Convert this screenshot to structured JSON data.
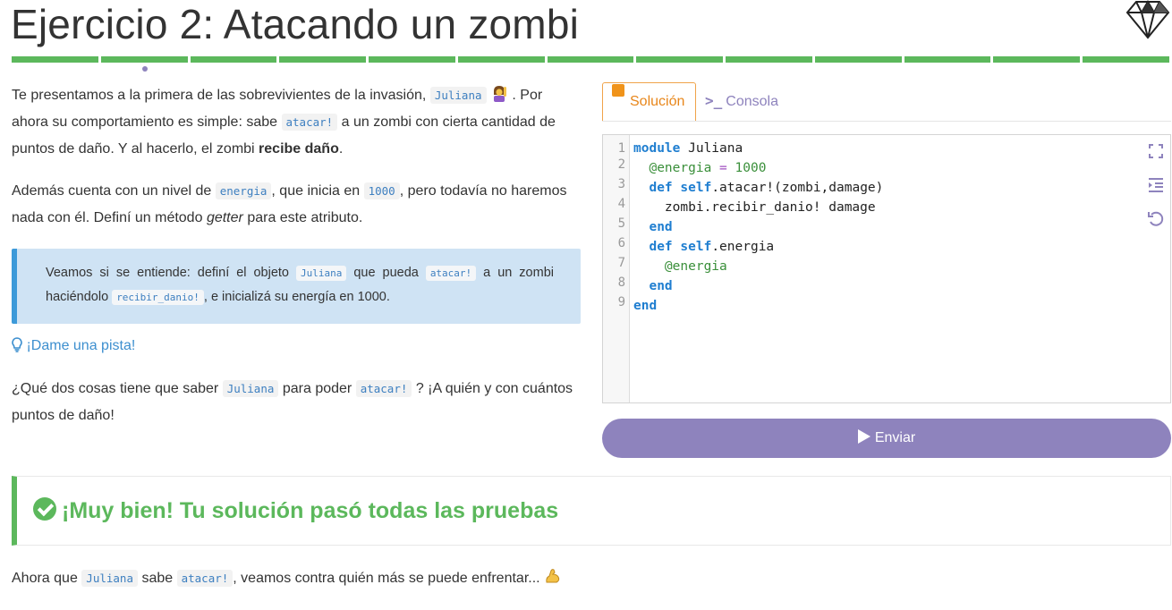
{
  "exercise": {
    "title": "Ejercicio 2: Atacando un zombi"
  },
  "progress": {
    "segments": 13,
    "current_index": 1
  },
  "description": {
    "p1_a": "Te presentamos a la primera de las sobrevivientes de la invasión,",
    "p1_code_name": "Juliana",
    "p1_b": ". Por ahora su comportamiento es simple: sabe",
    "p1_code_attack": "atacar!",
    "p1_c": "a un zombi con cierta cantidad de puntos de daño. Y al hacerlo, el zombi",
    "p1_bold": "recibe daño",
    "p1_d": ".",
    "p2_a": "Además cuenta con un nivel de",
    "p2_code_energy": "energia",
    "p2_b": ", que inicia en",
    "p2_code_1000": "1000",
    "p2_c": ", pero todavía no haremos nada con él. Definí un método",
    "p2_em": "getter",
    "p2_d": "para este atributo."
  },
  "callout": {
    "a": "Veamos si se entiende: definí el objeto",
    "code_name": "Juliana",
    "b": "que pueda",
    "code_attack": "atacar!",
    "c": "a un zombi haciéndolo",
    "code_receive": "recibir_danio!",
    "d": ", e inicializá su energía en 1000."
  },
  "hint": {
    "label": "¡Dame una pista!"
  },
  "question": {
    "a": "¿Qué dos cosas tiene que saber",
    "code_name": "Juliana",
    "b": "para poder",
    "code_attack": "atacar!",
    "c": "? ¡A quién y con cuántos puntos de daño!"
  },
  "tabs": {
    "solution": "Solución",
    "console": "Consola"
  },
  "editor": {
    "lines": [
      "module Juliana",
      "  @energia = 1000",
      "  def self.atacar!(zombi,damage)",
      "    zombi.recibir_danio! damage",
      "  end",
      "  def self.energia",
      "    @energia",
      "  end",
      "end"
    ]
  },
  "send_button": {
    "label": "Enviar"
  },
  "result": {
    "message": "¡Muy bien! Tu solución pasó todas las pruebas"
  },
  "corollary": {
    "a": "Ahora que",
    "code_name": "Juliana",
    "b": "sabe",
    "code_attack": "atacar!",
    "c": ", veamos contra quién más se puede enfrentar..."
  },
  "colors": {
    "success": "#5cb85c",
    "brand": "#8e83bd",
    "info": "#3d9ad9",
    "accent": "#f0931a"
  },
  "icons": [
    "ruby-logo-icon",
    "woman-raising-hand-emoji",
    "lightbulb-icon",
    "edit-icon",
    "terminal-icon",
    "fullscreen-icon",
    "indent-icon",
    "reset-icon",
    "play-icon",
    "check-circle-icon",
    "flexed-biceps-emoji"
  ]
}
